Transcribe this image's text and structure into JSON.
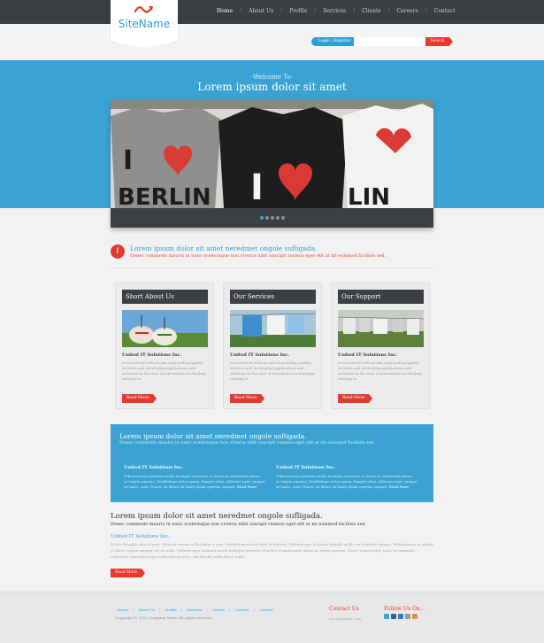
{
  "brand": {
    "name": "SiteName"
  },
  "nav": {
    "items": [
      {
        "label": "Home",
        "active": true
      },
      {
        "label": "About Us"
      },
      {
        "label": "Profile"
      },
      {
        "label": "Services"
      },
      {
        "label": "Clients"
      },
      {
        "label": "Careers"
      },
      {
        "label": "Contact"
      }
    ]
  },
  "header": {
    "login_label": "Login",
    "register_label": "Register",
    "search_placeholder": "",
    "search_button": "Search"
  },
  "hero": {
    "pretitle": "-Welcome To-",
    "title": "Lorem ipsum dolor sit amet",
    "slider_image": "berlin-tshirts",
    "slide_count": 5,
    "active_slide": 1
  },
  "notice": {
    "icon": "info-icon",
    "title": "Lorem ipsum dolor sit amet neredmet ongole sufligada.",
    "subtitle": "Donec commodo mauris in nunc scelerisque non viverra nibh suscipit rasmus eget elit at mi euismod facilisis sed."
  },
  "cards": [
    {
      "heading": "Short About Us",
      "image": "shoes-outdoors",
      "company": "United IT Solutions Inc.",
      "text": "ever evolved with an aim of providing quality services and developing applications and solutions in the area of information technology relating to",
      "button": "Read More"
    },
    {
      "heading": "Our Services",
      "image": "laundry-line",
      "company": "United IT Solutions Inc.",
      "text": "ever evolved with an aim of providing quality services and developing applications and solutions in the area of information technology relating to",
      "button": "Read More"
    },
    {
      "heading": "Our Support",
      "image": "laundry-yard",
      "company": "United IT Solutions Inc.",
      "text": "ever evolved with an aim of providing quality services and developing applications and solutions in the area of information technology relating to",
      "button": "Read More"
    }
  ],
  "info": {
    "title": "Lorem ipsum dolor sit amet neredmet ongole sufligada.",
    "subtitle": "Donec commodo mauris in nunc scelerisque non viverra nibh suscipit rasmus eget elit at mi euismod facilisis sed.",
    "columns": [
      {
        "title": "United IT Solutions Inc.",
        "text": "Pellentesque habitant morbi tristique senectus et netus et malesuada fames ac turpis egestas. Vestibulum tortor quam, feugiat vitae, ultricies eget, tempor sit amet, ante. Donec eu libero sit amet quam egestas semper.",
        "more": "Read More"
      },
      {
        "title": "United IT Solutions Inc.",
        "text": "Pellentesque habitant morbi tristique senectus et netus et malesuada fames ac turpis egestas. Vestibulum tortor quam, feugiat vitae, ultricies eget, tempor sit amet, ante. Donec eu libero sit amet quam egestas semper.",
        "more": "Read More"
      }
    ]
  },
  "lower": {
    "title": "Lorem ipsum dolor sit amet neredmet ongole sufligada.",
    "subtitle": "Donec commodo mauris in nunc scelerisque non viverra nibh suscipit rasmus eget elit at mi euismod facilisis sed.",
    "link": "United IT Solutions Inc.",
    "text": "Donec fringilla odio et nunc rhoncus rutrum sollicitudin a arcu. Vestibulum auctor nibh at lobortis. Pellentesque id metus blandit mollis est volutpat tempus. Pellentesque in mattis et libero sapien semper vel eu nulla. Pellentesque habitant morbi tristique senectus et netus et malesuada fames ac turpis egestas. Donec consectetur, justo et commodo vulputate, convallis turpis nulla rutrum arcu, sed blandit nulla dui et nulla.",
    "button": "Read More"
  },
  "footer": {
    "links": [
      "Home",
      "About Us",
      "Profile",
      "Services",
      "Clients",
      "Careers",
      "Contact"
    ],
    "copyright": "Copyright © 2013 Company Name All rights reserved",
    "contact_heading": "Contact Us",
    "contact_text": "abc@domain.com",
    "follow_heading": "Follow Us On...",
    "social": [
      {
        "icon": "twitter-icon",
        "color": "#3aa3d4"
      },
      {
        "icon": "facebook-icon",
        "color": "#3b5998"
      },
      {
        "icon": "linkedin-icon",
        "color": "#2a7fb8"
      },
      {
        "icon": "google-plus-icon",
        "color": "#999999"
      },
      {
        "icon": "rss-icon",
        "color": "#e8892e"
      }
    ]
  },
  "colors": {
    "accent_blue": "#3aa3d4",
    "accent_red": "#e43a2f",
    "dark": "#3a3d42"
  }
}
